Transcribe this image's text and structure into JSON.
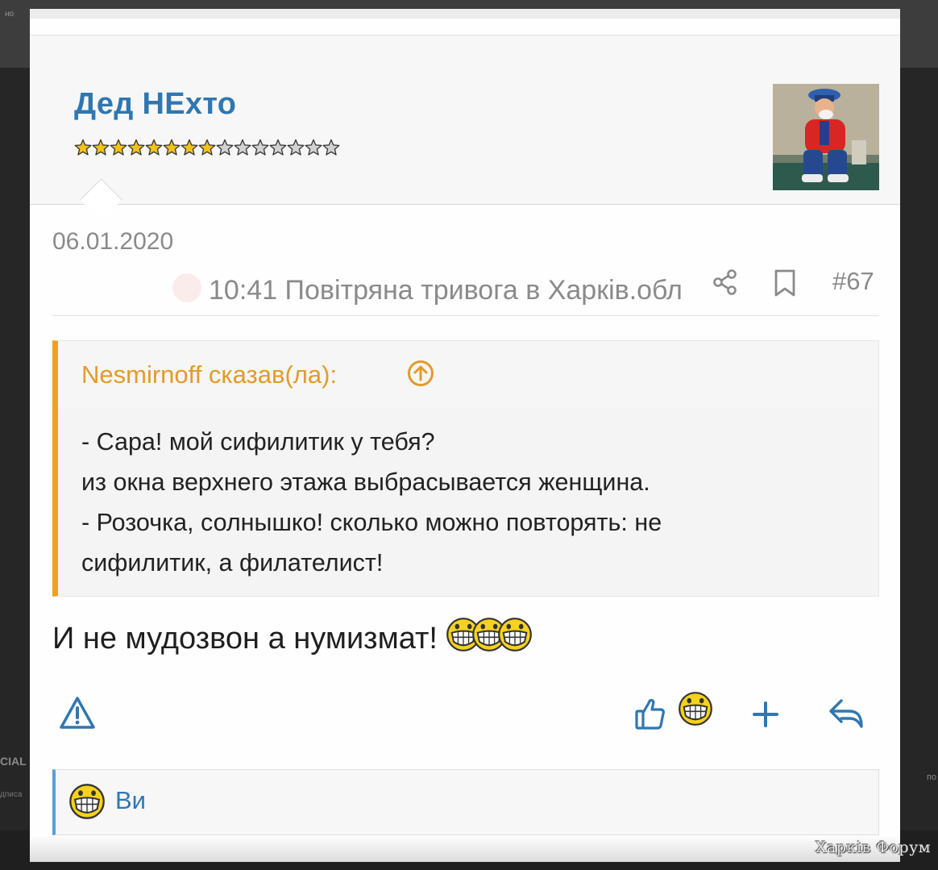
{
  "backdrop": {
    "top_mini": "но",
    "left_label": "CIAL",
    "left_small": "дписа",
    "right_small": "по"
  },
  "post": {
    "author": "Дед НЕхто",
    "stars_filled": 8,
    "stars_total": 15,
    "date": "06.01.2020",
    "ticker": "10:41 Повітряна тривога в Харків.обл",
    "post_number": "#67"
  },
  "quote": {
    "author_label": "Nesmirnoff сказав(ла):",
    "lines": [
      "- Сара! мой сифилитик у тебя?",
      "из окна верхнего этажа выбрасывается женщина.",
      "- Розочка, солнышко! сколько можно повторять: не",
      "сифилитик, а филателист!"
    ]
  },
  "reply": {
    "text": "И не мудозвон а нумизмат!",
    "smiley_count": 3
  },
  "reactions": {
    "who": "Ви"
  },
  "watermark": "Харків Форум",
  "colors": {
    "accent_blue": "#2f77b1",
    "quote_orange": "#f0a020",
    "muted": "#8a8a8a",
    "star_gold": "#f2c21a"
  }
}
